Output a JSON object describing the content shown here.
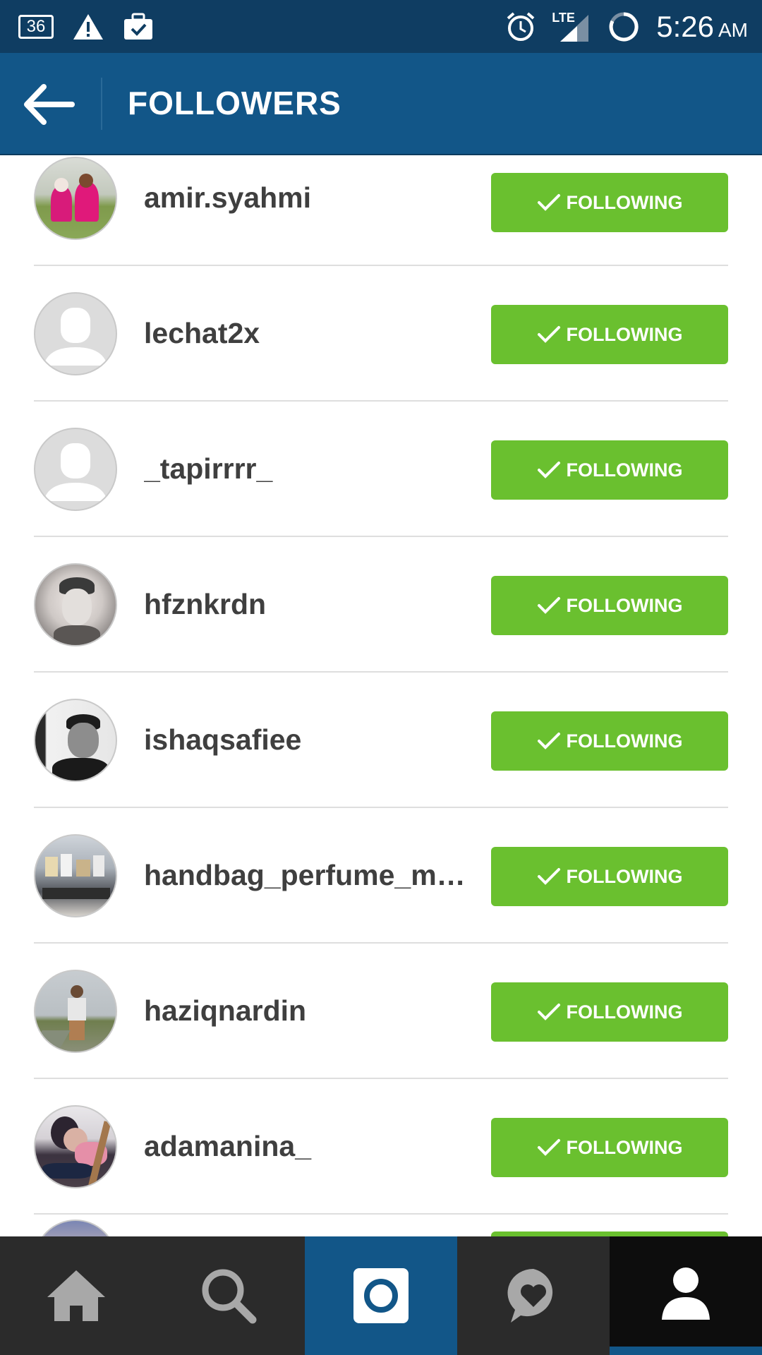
{
  "status_bar": {
    "badge": "36",
    "time": "5:26",
    "ampm": "AM",
    "network": "LTE",
    "icons": [
      "notification-badge-icon",
      "warning-icon",
      "briefcase-check-icon",
      "alarm-icon",
      "lte-signal-icon",
      "loading-ring-icon"
    ]
  },
  "header": {
    "title": "FOLLOWERS",
    "back_icon": "arrow-left-icon"
  },
  "follow_button_label": "FOLLOWING",
  "followers": [
    {
      "username": "amir.syahmi",
      "avatar": "photo"
    },
    {
      "username": "lechat2x",
      "avatar": "default"
    },
    {
      "username": "_tapirrrr_",
      "avatar": "default"
    },
    {
      "username": "hfznkrdn",
      "avatar": "photo"
    },
    {
      "username": "ishaqsafiee",
      "avatar": "photo"
    },
    {
      "username": "handbag_perfume_mu...",
      "avatar": "photo"
    },
    {
      "username": "haziqnardin",
      "avatar": "photo"
    },
    {
      "username": "adamanina_",
      "avatar": "photo"
    }
  ],
  "bottom_nav": {
    "items": [
      "home-icon",
      "search-icon",
      "camera-icon",
      "activity-heart-icon",
      "profile-icon"
    ],
    "active": "profile-icon",
    "colors": {
      "bar": "#2b2b2b",
      "camera_bg": "#125688",
      "profile_bg": "#0d0d0d",
      "icon": "#a8a8a8"
    }
  },
  "colors": {
    "status_bar": "#0f3d62",
    "header": "#125688",
    "following_button": "#6ac02f",
    "username_text": "#3f3f3f"
  }
}
